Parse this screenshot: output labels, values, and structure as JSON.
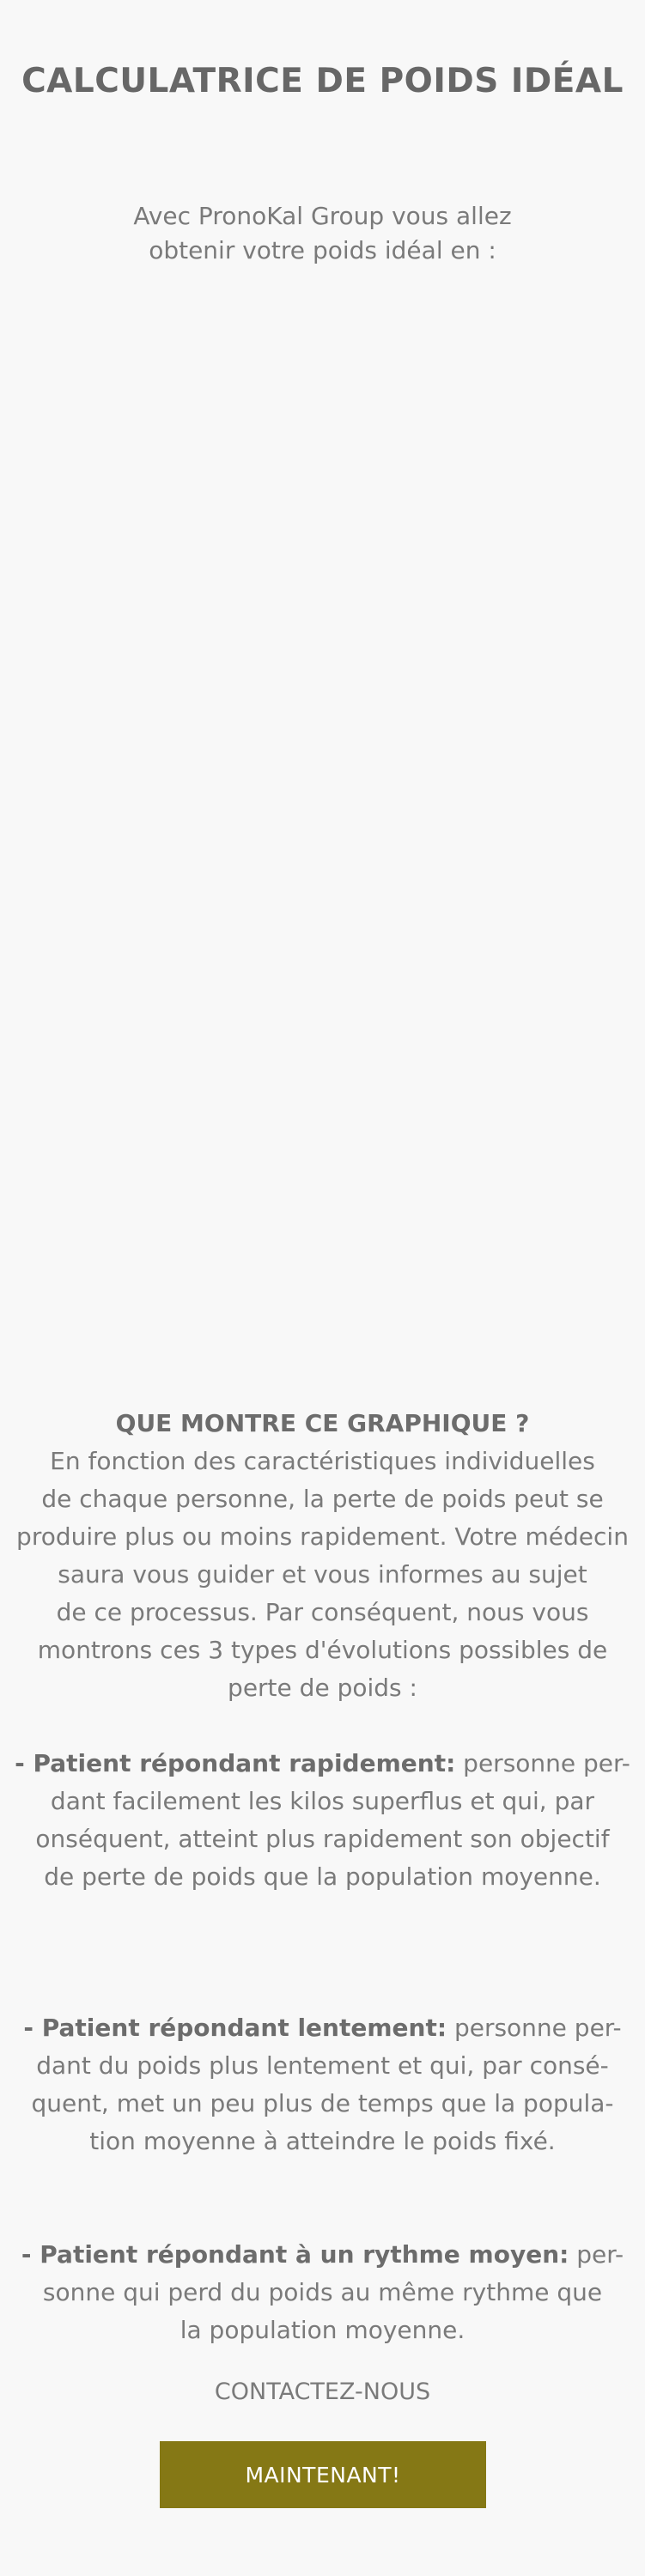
{
  "header": {
    "title": "CALCULATRICE DE POIDS IDÉAL"
  },
  "intro": {
    "lines": [
      "Avec PronoKal Group vous allez",
      "obtenir votre poids idéal en :"
    ]
  },
  "explanation": {
    "heading": "QUE MONTRE CE GRAPHIQUE ?",
    "paragraph_lines": [
      "En fonction des caractéristiques individuelles",
      "de chaque personne, la perte de poids peut se",
      "produire plus ou moins rapidement. Votre médecin",
      "saura vous guider et vous informes au sujet",
      "de ce processus. Par conséquent, nous vous",
      "montrons ces 3 types d'évolutions possibles de",
      "perte de poids :"
    ],
    "fast": {
      "label": "- Patient répondant rapidement:",
      "first_line_rest": " personne per-",
      "lines": [
        "dant facilement les kilos superflus et qui, par",
        "onséquent, atteint plus rapidement son objectif",
        "de perte de poids que la population moyenne."
      ]
    },
    "slow": {
      "label": "- Patient répondant lentement:",
      "first_line_rest": " personne per-",
      "lines": [
        "dant du poids plus lentement et qui, par consé-",
        "quent, met un peu plus de temps que la popula-",
        "tion moyenne à atteindre le poids fixé."
      ]
    },
    "average": {
      "label": "- Patient répondant à un rythme moyen:",
      "first_line_rest": " per-",
      "lines": [
        "sonne qui perd du poids au même rythme que",
        "la population moyenne."
      ]
    }
  },
  "contact": {
    "label": "CONTACTEZ-NOUS",
    "button_label": "MAINTENANT!"
  },
  "colors": {
    "background": "#f8f8f8",
    "text": "#7a7a7a",
    "button": "#857815",
    "button_text": "#ffffff"
  }
}
